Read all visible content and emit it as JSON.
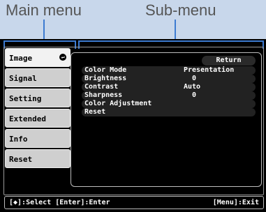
{
  "callouts": {
    "main_menu": "Main menu",
    "sub_menu": "Sub-menu"
  },
  "main_menu": {
    "items": [
      {
        "label": "Image",
        "selected": true
      },
      {
        "label": "Signal"
      },
      {
        "label": "Setting"
      },
      {
        "label": "Extended"
      },
      {
        "label": "Info"
      },
      {
        "label": "Reset"
      }
    ],
    "enter_icon": "enter-arrow-icon"
  },
  "sub_menu": {
    "return_label": "Return",
    "rows": [
      {
        "label": "Color Mode",
        "value": "Presentation"
      },
      {
        "label": "Brightness",
        "value": "0"
      },
      {
        "label": "Contrast",
        "value": "Auto"
      },
      {
        "label": "Sharpness",
        "value": "0"
      },
      {
        "label": "Color Adjustment",
        "value": ""
      },
      {
        "label": "Reset",
        "value": ""
      }
    ]
  },
  "status": {
    "left": "[◆]:Select [Enter]:Enter",
    "right": "[Menu]:Exit"
  },
  "colors": {
    "callout_background": "#c8d7eb",
    "bracket_blue": "#3d7bd1",
    "screen_black": "#000000"
  }
}
